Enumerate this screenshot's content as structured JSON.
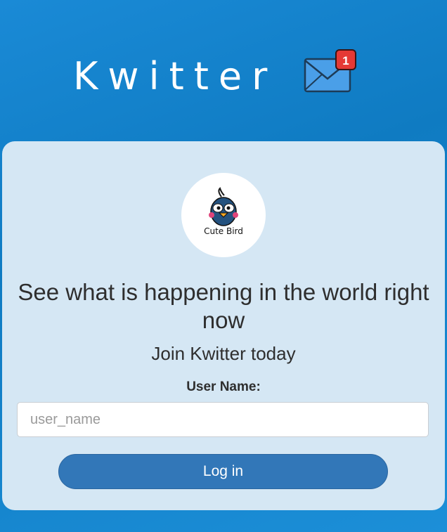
{
  "header": {
    "brand": "Kwitter",
    "notification_icon": "mail-icon",
    "notification_count": "1",
    "colors": {
      "background": "#1a8ad6",
      "mail": "#4a9fe8",
      "badge": "#e53935"
    }
  },
  "card": {
    "logo_text": "Cute Bird",
    "headline": "See what is happening in the world right now",
    "subhead": "Join Kwitter today",
    "username_label": "User Name:",
    "username_placeholder": "user_name",
    "username_value": "",
    "login_label": "Log in",
    "colors": {
      "card": "#d5e7f4",
      "button": "#3277b8"
    }
  }
}
